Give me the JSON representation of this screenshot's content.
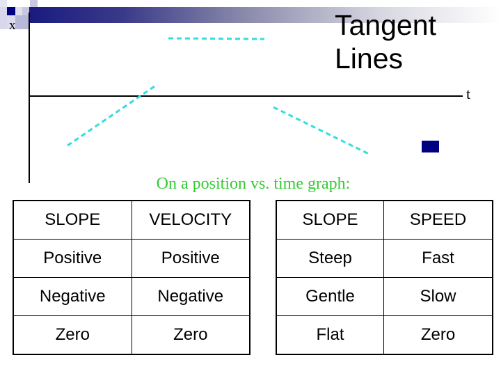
{
  "slide": {
    "title_lines": [
      "Tangent",
      "Lines"
    ],
    "subtitle": "On a position vs. time graph:",
    "colors": {
      "accent_navy": "#000080",
      "tangent_line": "#33dddd",
      "subtitle_green": "#33cc33",
      "banner_start": "#1a1a80"
    }
  },
  "graph": {
    "y_axis_label": "x",
    "x_axis_label": "t",
    "tangent_lines": [
      {
        "name": "positive-slope",
        "slope_sign": "positive"
      },
      {
        "name": "zero-slope",
        "slope_sign": "zero"
      },
      {
        "name": "negative-slope",
        "slope_sign": "negative"
      }
    ]
  },
  "tables": {
    "velocity": {
      "headers": [
        "SLOPE",
        "VELOCITY"
      ],
      "rows": [
        [
          "Positive",
          "Positive"
        ],
        [
          "Negative",
          "Negative"
        ],
        [
          "Zero",
          "Zero"
        ]
      ]
    },
    "speed": {
      "headers": [
        "SLOPE",
        "SPEED"
      ],
      "rows": [
        [
          "Steep",
          "Fast"
        ],
        [
          "Gentle",
          "Slow"
        ],
        [
          "Flat",
          "Zero"
        ]
      ]
    }
  }
}
